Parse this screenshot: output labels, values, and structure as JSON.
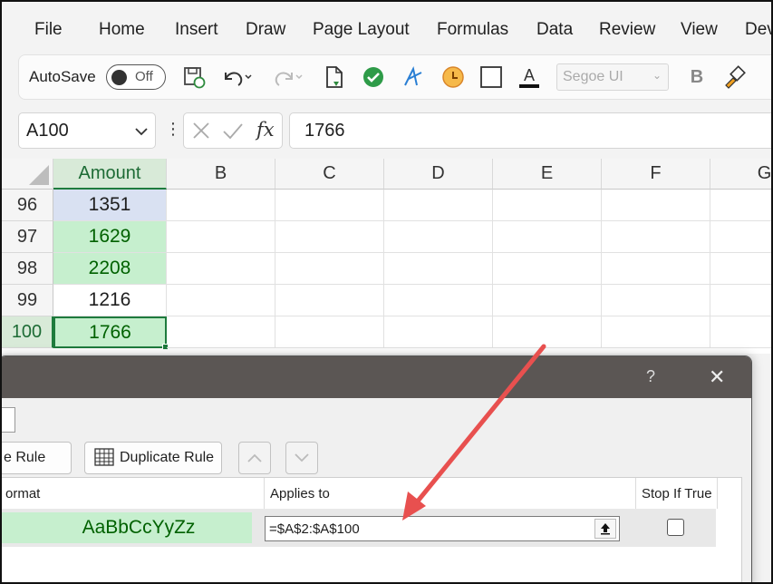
{
  "ribbon": {
    "tabs": [
      "File",
      "Home",
      "Insert",
      "Draw",
      "Page Layout",
      "Formulas",
      "Data",
      "Review",
      "View",
      "Dev"
    ]
  },
  "toolbar": {
    "autosave_label": "AutoSave",
    "autosave_state": "Off",
    "font_name": "Segoe UI",
    "bold_label": "B",
    "font_color_label": "A"
  },
  "formula_bar": {
    "name_box": "A100",
    "fx_label": "fx",
    "value": "1766"
  },
  "sheet": {
    "column_headers": [
      "Amount",
      "B",
      "C",
      "D",
      "E",
      "F",
      "G"
    ],
    "rows": [
      {
        "num": "96",
        "value": "1351"
      },
      {
        "num": "97",
        "value": "1629"
      },
      {
        "num": "98",
        "value": "2208"
      },
      {
        "num": "99",
        "value": "1216"
      },
      {
        "num": "100",
        "value": "1766"
      }
    ]
  },
  "dialog": {
    "help_label": "?",
    "close_label": "✕",
    "edit_rule_label": "e Rule",
    "duplicate_rule_label": "Duplicate Rule",
    "col_format": "ormat",
    "col_applies": "Applies to",
    "col_stop": "Stop If True",
    "preview_text": "AaBbCcYyZz",
    "applies_value": "=$A$2:$A$100"
  },
  "colors": {
    "accent": "#1e7b3d",
    "good_fill": "#c6efce",
    "good_text": "#006100",
    "arrow": "#e8504f"
  }
}
